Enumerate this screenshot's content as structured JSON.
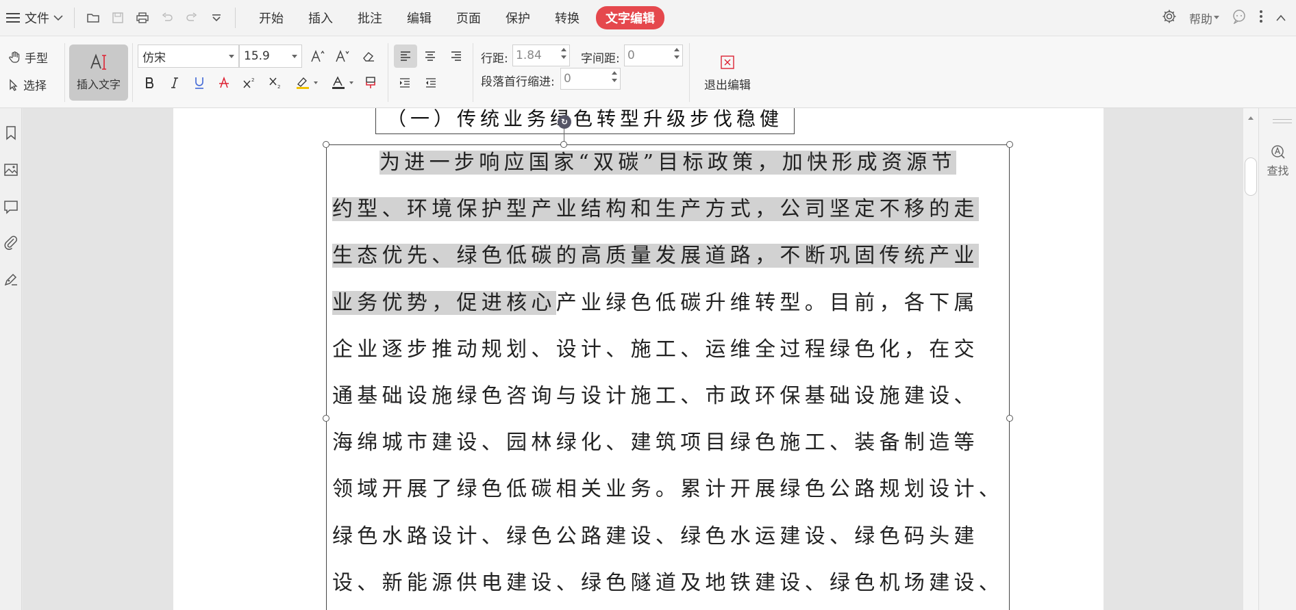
{
  "menubar": {
    "file_label": "文件",
    "tabs": [
      {
        "label": "开始"
      },
      {
        "label": "插入"
      },
      {
        "label": "批注"
      },
      {
        "label": "编辑"
      },
      {
        "label": "页面"
      },
      {
        "label": "保护"
      },
      {
        "label": "转换"
      }
    ],
    "active_tab": "文字编辑",
    "help_label": "帮助"
  },
  "ribbon": {
    "hand_tool": "手型",
    "select_tool": "选择",
    "insert_text": "插入文字",
    "font_name": "仿宋",
    "font_size": "15.9",
    "line_spacing_label": "行距:",
    "line_spacing_value": "1.84",
    "char_spacing_label": "字间距:",
    "char_spacing_value": "0",
    "first_indent_label": "段落首行缩进:",
    "first_indent_value": "0",
    "exit_edit": "退出编辑"
  },
  "right_panel": {
    "find_label": "查找"
  },
  "document": {
    "heading": "（一）传统业务绿色转型升级步伐稳健",
    "lines": [
      {
        "hl": "为进一步响应国家“双碳”目标政策，加快形成资源节",
        "rest": ""
      },
      {
        "hl": "约型、环境保护型产业结构和生产方式，公司坚定不移的走",
        "rest": ""
      },
      {
        "hl": "生态优先、绿色低碳的高质量发展道路，不断巩固传统产业",
        "rest": ""
      },
      {
        "hl": "业务优势，促进核心",
        "rest": "产业绿色低碳升维转型。目前，各下属"
      },
      {
        "hl": "",
        "rest": "企业逐步推动规划、设计、施工、运维全过程绿色化，在交"
      },
      {
        "hl": "",
        "rest": "通基础设施绿色咨询与设计施工、市政环保基础设施建设、"
      },
      {
        "hl": "",
        "rest": "海绵城市建设、园林绿化、建筑项目绿色施工、装备制造等"
      },
      {
        "hl": "",
        "rest": "领域开展了绿色低碳相关业务。累计开展绿色公路规划设计、"
      },
      {
        "hl": "",
        "rest": "绿色水路设计、绿色公路建设、绿色水运建设、绿色码头建"
      },
      {
        "hl": "",
        "rest": "设、新能源供电建设、绿色隧道及地铁建设、绿色机场建设、"
      }
    ]
  },
  "colors": {
    "accent": "#e5484d",
    "highlight": "#d2d2d2"
  }
}
